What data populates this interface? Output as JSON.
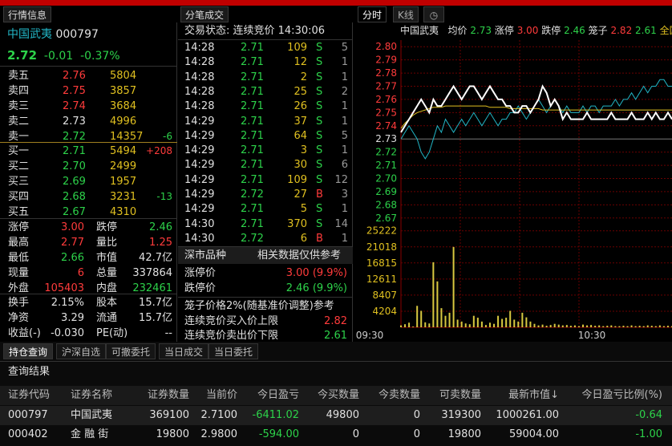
{
  "tabs": {
    "quote": "行情信息",
    "ticks": "分笔成交",
    "intraday": "分时",
    "kline": "K线",
    "clock_icon": "clock-icon"
  },
  "stock": {
    "name": "中国武夷",
    "code": "000797",
    "price": "2.72",
    "change": "-0.01",
    "pct": "-0.37%"
  },
  "asks": [
    {
      "label": "卖五",
      "price": "2.76",
      "vol": "5804",
      "chg": ""
    },
    {
      "label": "卖四",
      "price": "2.75",
      "vol": "3857",
      "chg": ""
    },
    {
      "label": "卖三",
      "price": "2.74",
      "vol": "3684",
      "chg": ""
    },
    {
      "label": "卖二",
      "price": "2.73",
      "vol": "4996",
      "chg": ""
    },
    {
      "label": "卖一",
      "price": "2.72",
      "vol": "14357",
      "chg": "-6"
    }
  ],
  "bids": [
    {
      "label": "买一",
      "price": "2.71",
      "vol": "5494",
      "chg": "+208"
    },
    {
      "label": "买二",
      "price": "2.70",
      "vol": "2499",
      "chg": ""
    },
    {
      "label": "买三",
      "price": "2.69",
      "vol": "1957",
      "chg": ""
    },
    {
      "label": "买四",
      "price": "2.68",
      "vol": "3231",
      "chg": "-13"
    },
    {
      "label": "买五",
      "price": "2.67",
      "vol": "4310",
      "chg": ""
    }
  ],
  "stats": [
    {
      "l1": "涨停",
      "v1": "3.00",
      "l2": "跌停",
      "v2": "2.46"
    },
    {
      "l1": "最高",
      "v1": "2.77",
      "l2": "量比",
      "v2": "1.25"
    },
    {
      "l1": "最低",
      "v1": "2.66",
      "l2": "市值",
      "v2": "42.7亿"
    },
    {
      "l1": "现量",
      "v1": "6",
      "l2": "总量",
      "v2": "337864"
    },
    {
      "l1": "外盘",
      "v1": "105403",
      "l2": "内盘",
      "v2": "232461"
    }
  ],
  "stats2": [
    {
      "l1": "换手",
      "v1": "2.15%",
      "l2": "股本",
      "v2": "15.7亿"
    },
    {
      "l1": "净资",
      "v1": "3.29",
      "l2": "流通",
      "v2": "15.7亿"
    },
    {
      "l1": "收益(-)",
      "v1": "-0.030",
      "l2": "PE(动)",
      "v2": "--"
    }
  ],
  "trade_status": "交易状态: 连续竞价 14:30:06",
  "ticks": [
    {
      "t": "14:28",
      "p": "2.71",
      "v": "109",
      "s": "S",
      "n": "5"
    },
    {
      "t": "14:28",
      "p": "2.71",
      "v": "12",
      "s": "S",
      "n": "1"
    },
    {
      "t": "14:28",
      "p": "2.71",
      "v": "2",
      "s": "S",
      "n": "1"
    },
    {
      "t": "14:28",
      "p": "2.71",
      "v": "25",
      "s": "S",
      "n": "2"
    },
    {
      "t": "14:28",
      "p": "2.71",
      "v": "26",
      "s": "S",
      "n": "1"
    },
    {
      "t": "14:29",
      "p": "2.71",
      "v": "37",
      "s": "S",
      "n": "1"
    },
    {
      "t": "14:29",
      "p": "2.71",
      "v": "64",
      "s": "S",
      "n": "5"
    },
    {
      "t": "14:29",
      "p": "2.71",
      "v": "3",
      "s": "S",
      "n": "1"
    },
    {
      "t": "14:29",
      "p": "2.71",
      "v": "30",
      "s": "S",
      "n": "6"
    },
    {
      "t": "14:29",
      "p": "2.71",
      "v": "109",
      "s": "S",
      "n": "12"
    },
    {
      "t": "14:29",
      "p": "2.72",
      "v": "27",
      "s": "B",
      "n": "3"
    },
    {
      "t": "14:29",
      "p": "2.71",
      "v": "5",
      "s": "S",
      "n": "1"
    },
    {
      "t": "14:30",
      "p": "2.71",
      "v": "370",
      "s": "S",
      "n": "14"
    },
    {
      "t": "14:30",
      "p": "2.72",
      "v": "6",
      "s": "B",
      "n": "1"
    }
  ],
  "market": {
    "title": "深市品种",
    "ref": "相关数据仅供参考",
    "limit_up_label": "涨停价",
    "limit_up": "3.00 (9.9%)",
    "limit_down_label": "跌停价",
    "limit_down": "2.46 (9.9%)",
    "cage": "笼子价格2%(随基准价调整)参考",
    "buy_label": "连续竞价买入价上限",
    "buy": "2.82",
    "sell_label": "连续竞价卖出价下限",
    "sell": "2.61"
  },
  "chart_header": {
    "name": "中国武夷",
    "avg_label": "均价",
    "avg": "2.73",
    "up_label": "涨停",
    "up": "3.00",
    "down_label": "跌停",
    "down": "2.46",
    "cage_label": "笼子",
    "cage1": "2.82",
    "cage2": "2.61",
    "extra": "全国地"
  },
  "chart_data": {
    "type": "line",
    "price_ticks": [
      "2.80",
      "2.79",
      "2.78",
      "2.77",
      "2.76",
      "2.75",
      "2.74",
      "2.73",
      "2.72",
      "2.71",
      "2.70",
      "2.69",
      "2.68",
      "2.67"
    ],
    "vol_ticks": [
      "25222",
      "21018",
      "16815",
      "12611",
      "8407",
      "4204"
    ],
    "x_ticks": [
      "09:30",
      "10:30"
    ],
    "prev_close": 2.73,
    "ylim": [
      2.665,
      2.805
    ],
    "series": [
      {
        "color": "#ffffff",
        "values": [
          2.735,
          2.74,
          2.745,
          2.75,
          2.755,
          2.76,
          2.755,
          2.75,
          2.76,
          2.755,
          2.755,
          2.76,
          2.765,
          2.77,
          2.765,
          2.76,
          2.765,
          2.77,
          2.77,
          2.765,
          2.76,
          2.765,
          2.77,
          2.765,
          2.76,
          2.76,
          2.755,
          2.755,
          2.75,
          2.75,
          2.755,
          2.755,
          2.75,
          2.755,
          2.76,
          2.77,
          2.765,
          2.755,
          2.76,
          2.755,
          2.745,
          2.75,
          2.745,
          2.745,
          2.745,
          2.745,
          2.75,
          2.745,
          2.745,
          2.745,
          2.745,
          2.745,
          2.75,
          2.745,
          2.745,
          2.745,
          2.745,
          2.75,
          2.745,
          2.745,
          2.745,
          2.75,
          2.745,
          2.75,
          2.745,
          2.745,
          2.75,
          2.745
        ]
      },
      {
        "color": "#e0c020",
        "values": [
          2.738,
          2.742,
          2.745,
          2.748,
          2.75,
          2.751,
          2.752,
          2.753,
          2.754,
          2.754,
          2.754,
          2.755,
          2.755,
          2.755,
          2.755,
          2.755,
          2.755,
          2.755,
          2.755,
          2.755,
          2.755,
          2.755,
          2.754,
          2.754,
          2.754,
          2.754,
          2.754,
          2.753,
          2.753,
          2.753,
          2.753,
          2.753,
          2.753,
          2.753,
          2.753,
          2.752,
          2.752,
          2.752,
          2.752,
          2.752,
          2.752,
          2.752,
          2.752,
          2.752,
          2.752,
          2.752,
          2.752,
          2.752,
          2.752,
          2.752,
          2.752,
          2.752,
          2.752,
          2.752,
          2.752,
          2.752,
          2.752,
          2.752,
          2.752,
          2.752,
          2.752,
          2.752,
          2.752,
          2.752,
          2.752,
          2.752,
          2.752,
          2.752
        ]
      },
      {
        "color": "#22b6c6",
        "values": [
          2.73,
          2.735,
          2.74,
          2.735,
          2.73,
          2.72,
          2.715,
          2.72,
          2.73,
          2.74,
          2.735,
          2.745,
          2.74,
          2.735,
          2.74,
          2.745,
          2.74,
          2.745,
          2.75,
          2.745,
          2.74,
          2.745,
          2.75,
          2.745,
          2.74,
          2.745,
          2.745,
          2.75,
          2.75,
          2.755,
          2.75,
          2.745,
          2.75,
          2.755,
          2.76,
          2.755,
          2.75,
          2.755,
          2.76,
          2.755,
          2.75,
          2.755,
          2.75,
          2.75,
          2.75,
          2.755,
          2.75,
          2.755,
          2.755,
          2.75,
          2.755,
          2.755,
          2.755,
          2.76,
          2.755,
          2.76,
          2.76,
          2.765,
          2.76,
          2.765,
          2.77,
          2.765,
          2.77,
          2.77,
          2.775,
          2.775,
          2.77,
          2.77
        ]
      }
    ],
    "volumes": [
      500,
      800,
      1200,
      200,
      5600,
      4300,
      1300,
      1000,
      17000,
      12000,
      5000,
      3000,
      3800,
      21000,
      2000,
      1500,
      1000,
      800,
      3000,
      2500,
      1500,
      600,
      1200,
      900,
      3000,
      2200,
      2500,
      4300,
      2000,
      1500,
      3800,
      2600,
      1500,
      900,
      500,
      700,
      400,
      600,
      900,
      700,
      500,
      600,
      400,
      500,
      300,
      700,
      500,
      600,
      400,
      500,
      300,
      400,
      500,
      300,
      300,
      400,
      300,
      500,
      300,
      400,
      300,
      500,
      400,
      300,
      500,
      300,
      400,
      300
    ],
    "vol_max": 26000
  },
  "bottom_tabs": [
    "持仓查询",
    "沪深自选",
    "可撤委托",
    "当日成交",
    "当日委托"
  ],
  "result_label": "查询结果",
  "columns": [
    "证券代码",
    "证券名称",
    "证券数量",
    "当前价",
    "今日盈亏",
    "今买数量",
    "今卖数量",
    "可卖数量",
    "最新市值↓",
    "今日盈亏比例(%)"
  ],
  "positions": [
    {
      "code": "000797",
      "name": "中国武夷",
      "qty": "369100",
      "price": "2.7100",
      "pnl": "-6411.02",
      "buy": "49800",
      "sell": "0",
      "avail": "319300",
      "mv": "1000261.00",
      "pct": "-0.64"
    },
    {
      "code": "000402",
      "name": "金 融 街",
      "qty": "19800",
      "price": "2.9800",
      "pnl": "-594.00",
      "buy": "0",
      "sell": "0",
      "avail": "19800",
      "mv": "59004.00",
      "pct": "-1.00"
    }
  ]
}
